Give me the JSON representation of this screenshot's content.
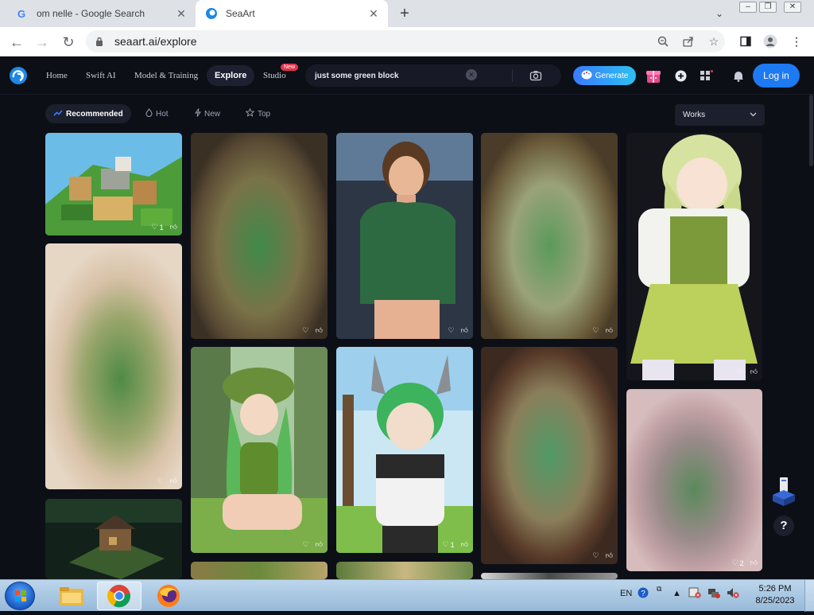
{
  "browser": {
    "tabs": [
      {
        "title": "om nelle - Google Search",
        "active": false
      },
      {
        "title": "SeaArt",
        "active": true
      }
    ],
    "url": "seaart.ai/explore"
  },
  "header": {
    "nav": [
      "Home",
      "Swift AI",
      "Model & Training",
      "Explore",
      "Studio"
    ],
    "studio_badge": "New",
    "search_value": "just some green block",
    "generate_label": "Generate",
    "login_label": "Log in"
  },
  "filters": {
    "chips": [
      "Recommended",
      "Hot",
      "New",
      "Top"
    ],
    "dropdown": "Works"
  },
  "cards": [
    {
      "likes": "1",
      "show_count": true
    },
    {
      "likes": "",
      "show_count": false
    },
    {
      "likes": "",
      "show_count": false
    },
    {
      "likes": "",
      "show_count": false
    },
    {
      "likes": "",
      "show_count": false
    },
    {
      "likes": "",
      "show_count": false
    },
    {
      "likes": "",
      "show_count": false
    },
    {
      "likes": "1",
      "show_count": true
    },
    {
      "likes": "",
      "show_count": false
    },
    {
      "likes": "2",
      "show_count": true
    }
  ],
  "help_label": "?",
  "taskbar": {
    "lang": "EN",
    "time": "5:26 PM",
    "date": "8/25/2023"
  },
  "colors": {
    "page_bg": "#0d0f17",
    "accent_blue": "#1d7af2",
    "badge_red": "#e0344d"
  }
}
